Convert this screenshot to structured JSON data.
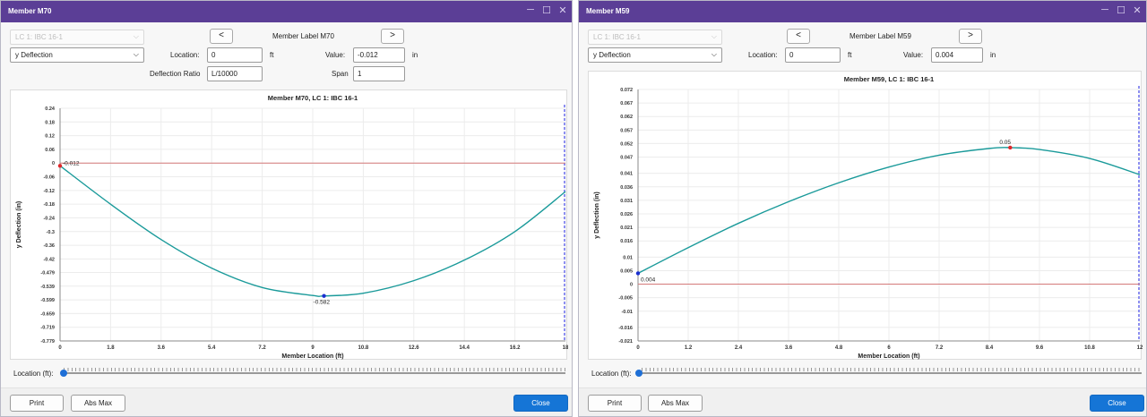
{
  "windows": [
    {
      "title": "Member M70",
      "load_case_placeholder": "LC 1: IBC 16-1",
      "result_type": "y Deflection",
      "member_label": "Member Label M70",
      "location_label": "Location:",
      "location_value": "0",
      "location_unit": "ft",
      "value_label": "Value:",
      "value_value": "-0.012",
      "value_unit": "in",
      "deflection_ratio_label": "Deflection Ratio",
      "deflection_ratio_value": "L/10000",
      "span_label": "Span",
      "span_value": "1",
      "slider_label": "Location (ft):",
      "buttons": {
        "print": "Print",
        "abs_max": "Abs Max",
        "close": "Close"
      }
    },
    {
      "title": "Member M59",
      "load_case_placeholder": "LC 1: IBC 16-1",
      "result_type": "y Deflection",
      "member_label": "Member Label M59",
      "location_label": "Location:",
      "location_value": "0",
      "location_unit": "ft",
      "value_label": "Value:",
      "value_value": "0.004",
      "value_unit": "in",
      "slider_label": "Location (ft):",
      "buttons": {
        "print": "Print",
        "abs_max": "Abs Max",
        "close": "Close"
      }
    }
  ],
  "icons": {
    "prev": "chevron-left-icon",
    "next": "chevron-right-icon",
    "dropdown": "chevron-down-icon",
    "minimize": "minimize-icon",
    "maximize": "maximize-icon",
    "close": "close-icon"
  },
  "glyphs": {
    "prev": "<",
    "next": ">",
    "dropdown": "⌵",
    "minimize": "─",
    "maximize": "☐",
    "close": "✕"
  },
  "colors": {
    "titlebar": "#5b3e96",
    "curve": "#1a9a9a",
    "zero_line": "#d47a7a",
    "min_marker": "#1a2fd0",
    "max_marker": "#e0262a",
    "primary_button": "#1575d6"
  },
  "chart_data": [
    {
      "type": "line",
      "title": "Member M70, LC 1: IBC 16-1",
      "xlabel": "Member Location (ft)",
      "ylabel": "y Deflection (in)",
      "xlim": [
        0,
        18
      ],
      "ylim": [
        -0.779,
        0.24
      ],
      "x_ticks": [
        "0",
        "1.8",
        "3.6",
        "5.4",
        "7.2",
        "9",
        "10.8",
        "12.6",
        "14.4",
        "16.2",
        "18"
      ],
      "y_ticks": [
        "0.24",
        "0.18",
        "0.12",
        "0.06",
        "0",
        "-0.06",
        "-0.12",
        "-0.18",
        "-0.24",
        "-0.3",
        "-0.36",
        "-0.42",
        "-0.479",
        "-0.539",
        "-0.599",
        "-0.659",
        "-0.719",
        "-0.779"
      ],
      "x": [
        0,
        1.8,
        3.6,
        5.4,
        7.2,
        9,
        9.4,
        10.8,
        12.6,
        14.4,
        16.2,
        18
      ],
      "y": [
        -0.012,
        -0.18,
        -0.335,
        -0.46,
        -0.545,
        -0.58,
        -0.582,
        -0.57,
        -0.515,
        -0.425,
        -0.3,
        -0.125
      ],
      "annotations": [
        {
          "x": 0,
          "y": -0.012,
          "label": "-0.012",
          "color": "#e0262a"
        },
        {
          "x": 9.4,
          "y": -0.582,
          "label": "-0.582",
          "color": "#1a2fd0"
        }
      ]
    },
    {
      "type": "line",
      "title": "Member M59, LC 1: IBC 16-1",
      "xlabel": "Member Location (ft)",
      "ylabel": "y Deflection (in)",
      "xlim": [
        0,
        12
      ],
      "ylim": [
        -0.021,
        0.072
      ],
      "x_ticks": [
        "0",
        "1.2",
        "2.4",
        "3.6",
        "4.8",
        "6",
        "7.2",
        "8.4",
        "9.6",
        "10.8",
        "12"
      ],
      "y_ticks": [
        "0.072",
        "0.067",
        "0.062",
        "0.057",
        "0.052",
        "0.047",
        "0.041",
        "0.036",
        "0.031",
        "0.026",
        "0.021",
        "0.016",
        "0.01",
        "0.005",
        "0",
        "-0.005",
        "-0.01",
        "-0.016",
        "-0.021"
      ],
      "x": [
        0,
        1.2,
        2.4,
        3.6,
        4.8,
        6,
        7.2,
        8.4,
        8.9,
        9.6,
        10.8,
        12
      ],
      "y": [
        0.004,
        0.0135,
        0.0225,
        0.0305,
        0.0375,
        0.0433,
        0.0477,
        0.0502,
        0.0505,
        0.0498,
        0.0465,
        0.0405
      ],
      "annotations": [
        {
          "x": 0,
          "y": 0.004,
          "label": "0.004",
          "color": "#1a2fd0"
        },
        {
          "x": 8.9,
          "y": 0.0505,
          "label": "0.05",
          "color": "#e0262a"
        }
      ]
    }
  ]
}
